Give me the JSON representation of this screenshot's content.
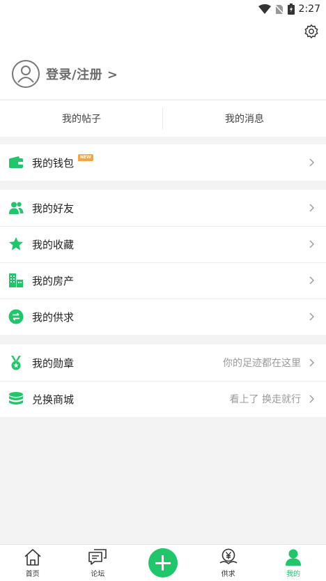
{
  "status_bar": {
    "time": "2:27"
  },
  "profile": {
    "login_label": "登录/注册 >"
  },
  "tabs": [
    {
      "label": "我的帖子"
    },
    {
      "label": "我的消息"
    }
  ],
  "wallet": {
    "label": "我的钱包",
    "badge": "NEW"
  },
  "social": [
    {
      "label": "我的好友",
      "icon": "friends-icon"
    },
    {
      "label": "我的收藏",
      "icon": "star-icon"
    },
    {
      "label": "我的房产",
      "icon": "building-icon"
    },
    {
      "label": "我的供求",
      "icon": "exchange-icon"
    }
  ],
  "rewards": [
    {
      "label": "我的勋章",
      "sub": "你的足迹都在这里",
      "icon": "medal-icon"
    },
    {
      "label": "兑换商城",
      "sub": "看上了 换走就行",
      "icon": "coins-icon"
    }
  ],
  "bottom_nav": [
    {
      "label": "首页"
    },
    {
      "label": "论坛"
    },
    {
      "label": ""
    },
    {
      "label": "供求"
    },
    {
      "label": "我的"
    }
  ],
  "colors": {
    "accent": "#1fc76a",
    "badge": "#f7a63c"
  }
}
